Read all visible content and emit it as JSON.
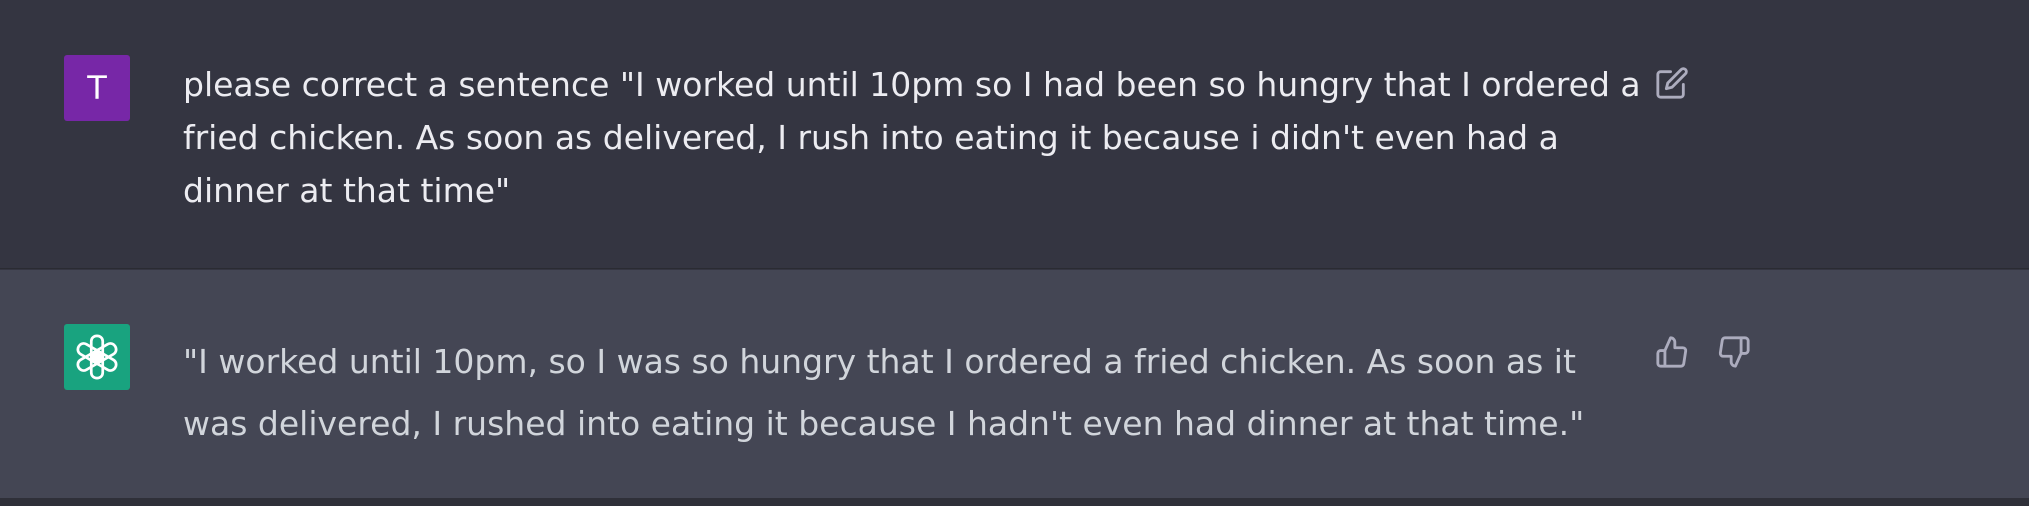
{
  "theme": {
    "user_row_bg": "#343541",
    "assistant_row_bg": "#444654",
    "user_avatar_bg": "#7727a7",
    "assistant_avatar_bg": "#19a37f",
    "icon_color": "#acacbe"
  },
  "conversation": {
    "user_message": {
      "avatar_initial": "T",
      "text": "please correct a sentence \"I worked until 10pm so I had been so hungry that I ordered a\nfried chicken. As soon as delivered, I rush into eating it because i didn't even had a\ndinner at that time\"",
      "edit_icon": "edit-icon"
    },
    "assistant_message": {
      "avatar_icon": "openai-logo-icon",
      "text": "\"I worked until 10pm, so I was so hungry that I ordered a fried chicken. As soon as it\nwas delivered, I rushed into eating it because I hadn't even had dinner at that time.\"",
      "feedback_icons": [
        "thumbs-up-icon",
        "thumbs-down-icon"
      ]
    }
  }
}
